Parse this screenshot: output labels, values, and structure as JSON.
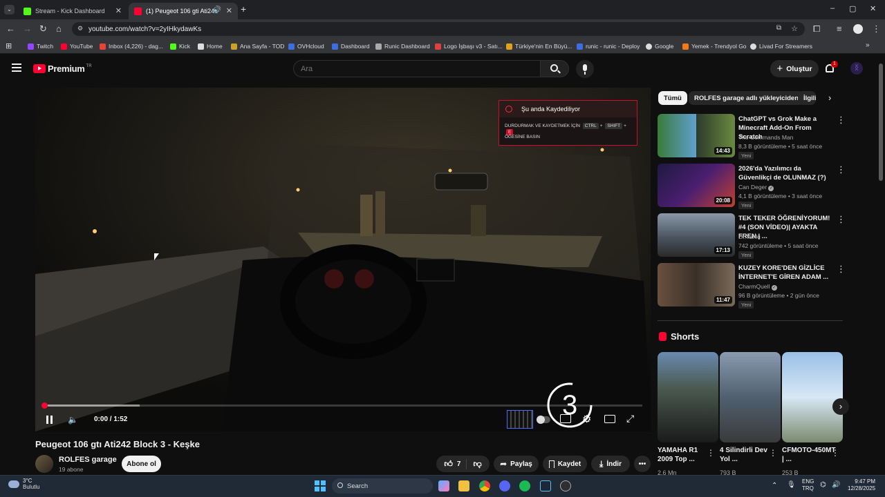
{
  "browser": {
    "tabs": [
      {
        "title": "Stream - Kick Dashboard",
        "fav_color": "#53fc18"
      },
      {
        "title": "(1) Peugeot 106 gti Ati242 ",
        "fav_color": "#ff0033"
      }
    ],
    "new_tab": "+",
    "url": "youtube.com/watch?v=2yIHkydawKs",
    "window_buttons": {
      "minimize": "–",
      "maximize": "▢",
      "close": "✕"
    }
  },
  "bookmarks": [
    {
      "label": "Twitch",
      "color": "#9146ff"
    },
    {
      "label": "YouTube",
      "color": "#ff0033"
    },
    {
      "label": "Inbox (4,226) - dag...",
      "color": "#ea4335"
    },
    {
      "label": "Kick",
      "color": "#53fc18"
    },
    {
      "label": "Home",
      "color": "#dddddd"
    },
    {
      "label": "Ana Sayfa - TOD",
      "color": "#c9a227"
    },
    {
      "label": "OVHcloud",
      "color": "#3c6ee0"
    },
    {
      "label": "Dashboard",
      "color": "#3c6ee0"
    },
    {
      "label": "Runic Dashboard",
      "color": "#aaaaaa"
    },
    {
      "label": "Logo İşbaşı v3 - Satı...",
      "color": "#e04040"
    },
    {
      "label": "Türkiye'nin En Büyü...",
      "color": "#e0a020"
    },
    {
      "label": "runic - runic - Deploy",
      "color": "#3c6ee0"
    },
    {
      "label": "Google",
      "color": "#dddddd"
    },
    {
      "label": "Yemek - Trendyol Go",
      "color": "#f27a1a"
    },
    {
      "label": "Livad For Streamers",
      "color": "#dddddd"
    }
  ],
  "youtube": {
    "logo_text": "Premium",
    "logo_badge": "TR",
    "search_placeholder": "Ara",
    "create_label": "Oluştur",
    "notif_count": "1"
  },
  "player": {
    "time": "0:00 / 1:52",
    "progress": 0.0,
    "buffered": 0.16,
    "countdown": "3",
    "rec_title": "Şu anda Kaydediliyor",
    "rec_line1": "DURDURMAK VE KAYDETMEK İÇİN",
    "rec_keys": [
      "CTRL",
      "SHIFT",
      "E"
    ],
    "rec_line2": "ÖĞESİNE BASIN"
  },
  "video": {
    "title": "Peugeot 106 gtı Ati242 Block 3 - Keşke",
    "channel": "ROLFES garage",
    "subscribers": "19 abone",
    "subscribe": "Abone ol",
    "likes": "7",
    "share": "Paylaş",
    "save": "Kaydet",
    "download": "İndir"
  },
  "sidebar": {
    "chips": [
      "Tümü",
      "ROLFES garage adlı yükleyiciden",
      "İlgili"
    ],
    "recommendations": [
      {
        "title": "ChatGPT vs Grok Make a Minecraft Add-On From Scratch",
        "channel": "The Commands Man",
        "meta": "8,3 B görüntüleme • 5 saat önce",
        "badge": "Yeni",
        "duration": "14:43",
        "verified": false
      },
      {
        "title": "2026'da Yazılımcı da Güvenlikçi de OLUNMAZ (?)",
        "channel": "Can Deger",
        "meta": "4,1 B görüntüleme • 3 saat önce",
        "badge": "Yeni",
        "duration": "20:08",
        "verified": true
      },
      {
        "title": "TEK TEKER ÖĞRENİYORUM! #4 (SON VİDEO)| AYAKTA FREN | ...",
        "channel": "Dr.Yankı",
        "meta": "742 görüntüleme • 5 saat önce",
        "badge": "Yeni",
        "duration": "17:13",
        "verified": false
      },
      {
        "title": "KUZEY KORE'DEN GİZLİCE İNTERNET'E GİREN ADAM ...",
        "channel": "CharmQuell",
        "meta": "96 B görüntüleme • 2 gün önce",
        "badge": "Yeni",
        "duration": "11:47",
        "verified": true
      }
    ],
    "shorts_label": "Shorts",
    "shorts": [
      {
        "title": "YAMAHA R1 2009 Top ...",
        "views": "2,6 Mn"
      },
      {
        "title": "4 Silindirli Dev Yol ...",
        "views": "793 B"
      },
      {
        "title": "CFMOTO-450MT | ...",
        "views": "253 B"
      }
    ]
  },
  "taskbar": {
    "weather_temp": "3°C",
    "weather_desc": "Bulutlu",
    "search": "Search",
    "lang1": "ENG",
    "lang2": "TRQ",
    "time": "9:47 PM",
    "date": "12/28/2025"
  }
}
